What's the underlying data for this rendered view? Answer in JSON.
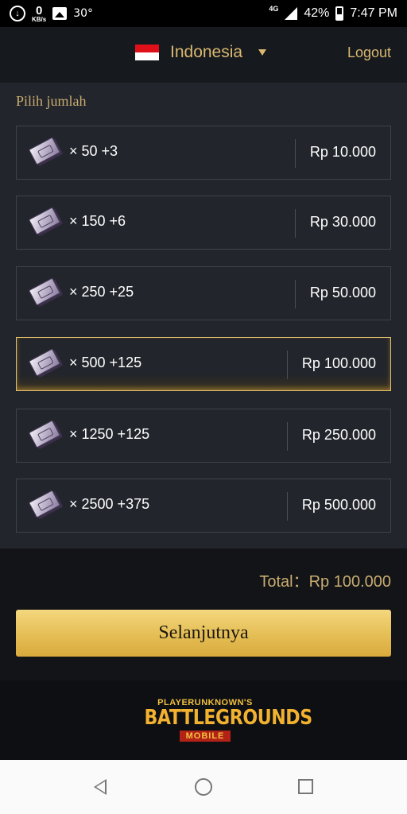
{
  "status_bar": {
    "speed_value": "0",
    "speed_unit": "KB/s",
    "temperature": "30°",
    "network": "4G",
    "battery": "42%",
    "time": "7:47 PM"
  },
  "header": {
    "country": "Indonesia",
    "logout_label": "Logout"
  },
  "section_title": "Pilih jumlah",
  "options": [
    {
      "qty": "× 50 +3",
      "price": "Rp 10.000",
      "selected": false
    },
    {
      "qty": "× 150 +6",
      "price": "Rp 30.000",
      "selected": false
    },
    {
      "qty": "× 250 +25",
      "price": "Rp 50.000",
      "selected": false
    },
    {
      "qty": "× 500 +125",
      "price": "Rp 100.000",
      "selected": true
    },
    {
      "qty": "× 1250 +125",
      "price": "Rp 250.000",
      "selected": false
    },
    {
      "qty": "× 2500 +375",
      "price": "Rp 500.000",
      "selected": false
    }
  ],
  "total": "Total：Rp 100.000",
  "next_button_label": "Selanjutnya",
  "logo": {
    "top": "PLAYERUNKNOWN'S",
    "main": "BATTLEGROUNDS",
    "sub": "MOBILE"
  },
  "colors": {
    "accent_gold": "#d9b871",
    "selected_border": "#e3c26e",
    "button_gold": "#e6c058",
    "flag_red": "#e0101a"
  }
}
